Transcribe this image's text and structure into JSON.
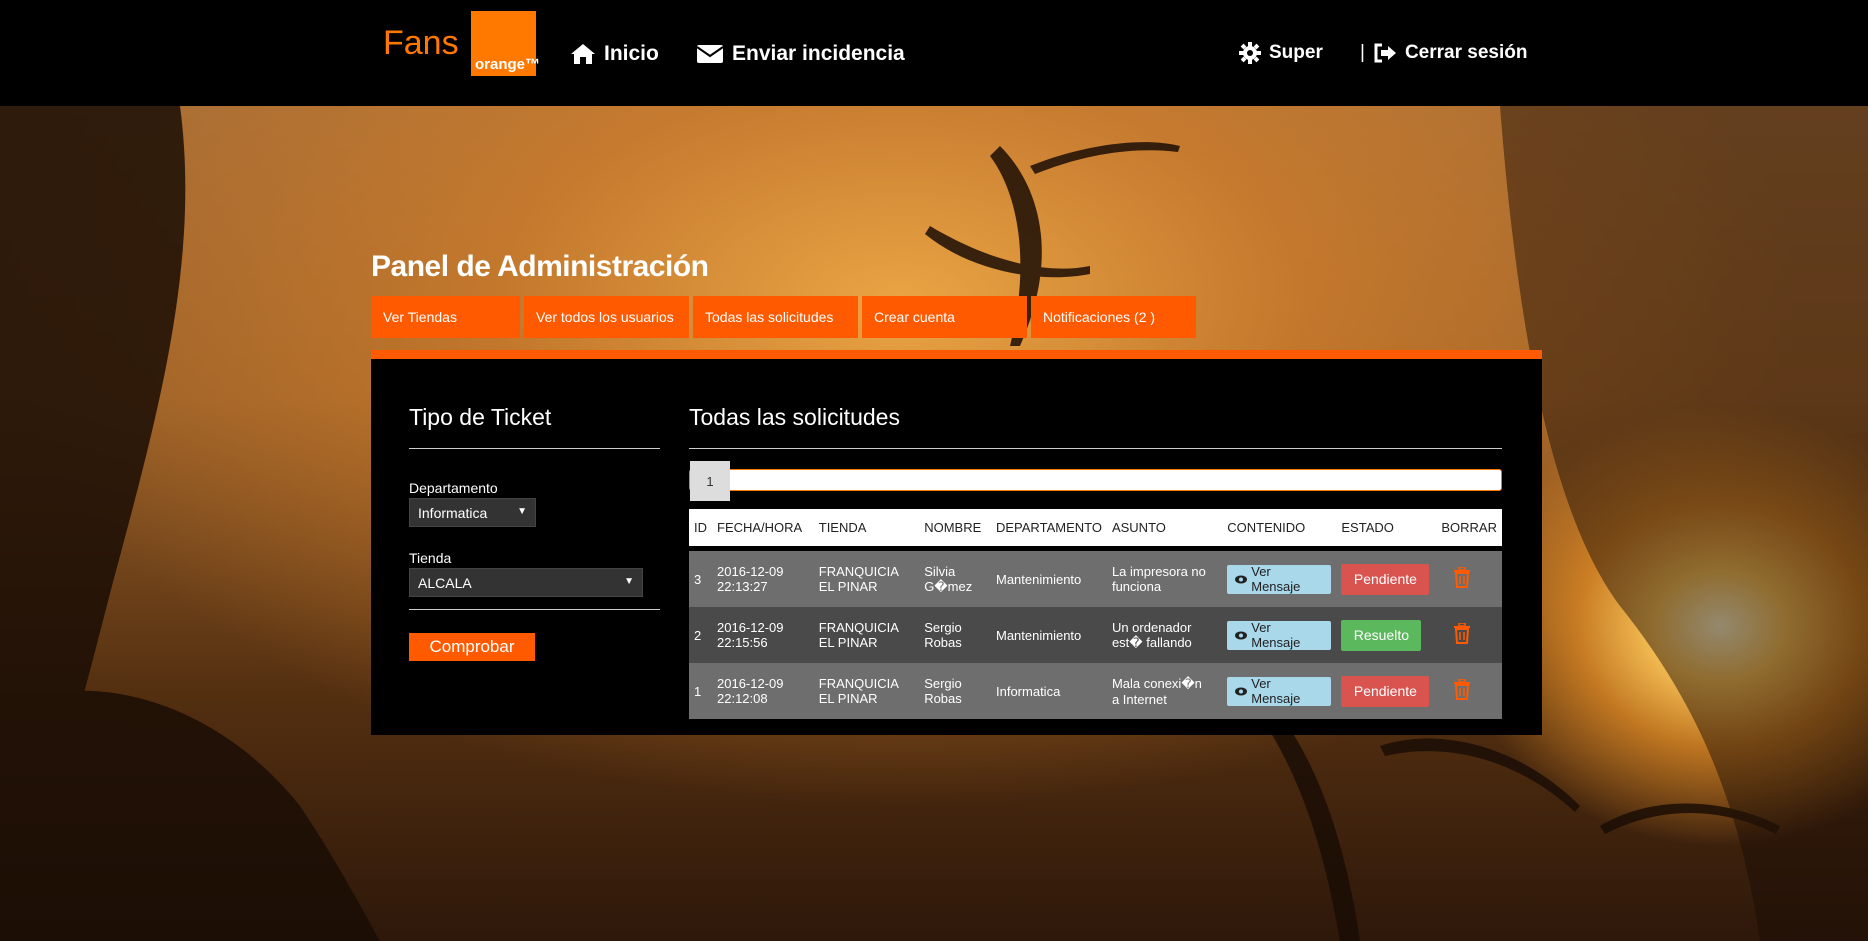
{
  "brand": {
    "text": "Fans",
    "logo_text": "orange™",
    "color": "#ff7900"
  },
  "nav": {
    "home_label": "Inicio",
    "report_label": "Enviar incidencia",
    "user_label": "Super",
    "logout_label": "Cerrar sesión",
    "logout_separator": "|"
  },
  "panel_title": "Panel de Administración",
  "tabs": [
    {
      "label": "Ver Tiendas"
    },
    {
      "label": "Ver todos los usuarios"
    },
    {
      "label": "Todas las solicitudes"
    },
    {
      "label": "Crear cuenta"
    },
    {
      "label": "Notificaciones (2 )"
    }
  ],
  "sidebar": {
    "title": "Tipo de Ticket",
    "department_label": "Departamento",
    "department_value": "Informatica",
    "store_label": "Tienda",
    "store_value": "ALCALA",
    "submit_label": "Comprobar"
  },
  "main": {
    "title": "Todas las solicitudes",
    "current_page": "1"
  },
  "table": {
    "headers": [
      "ID",
      "FECHA/HORA",
      "TIENDA",
      "NOMBRE",
      "DEPARTAMENTO",
      "ASUNTO",
      "CONTENIDO",
      "ESTADO",
      "BORRAR"
    ],
    "rows": [
      {
        "id": "3",
        "date": "2016-12-09",
        "time": "22:13:27",
        "store1": "FRANQUICIA",
        "store2": "EL PINAR",
        "name1": "Silvia",
        "name2": "G�mez",
        "department": "Mantenimiento",
        "subject1": "La impresora no",
        "subject2": "funciona",
        "content_label": "Ver Mensaje",
        "status": "Pendiente"
      },
      {
        "id": "2",
        "date": "2016-12-09",
        "time": "22:15:56",
        "store1": "FRANQUICIA",
        "store2": "EL PINAR",
        "name1": "Sergio",
        "name2": "Robas",
        "department": "Mantenimiento",
        "subject1": "Un ordenador",
        "subject2": "est� fallando",
        "content_label": "Ver Mensaje",
        "status": "Resuelto"
      },
      {
        "id": "1",
        "date": "2016-12-09",
        "time": "22:12:08",
        "store1": "FRANQUICIA",
        "store2": "EL PINAR",
        "name1": "Sergio",
        "name2": "Robas",
        "department": "Informatica",
        "subject1": "Mala conexi�n",
        "subject2": "a Internet",
        "content_label": "Ver Mensaje",
        "status": "Pendiente"
      }
    ]
  },
  "colors": {
    "accent": "#ff5a00",
    "pending": "#d9534f",
    "resolved": "#5cb85c",
    "view_button": "#a8d8ea",
    "trash": "#ff5a00"
  }
}
